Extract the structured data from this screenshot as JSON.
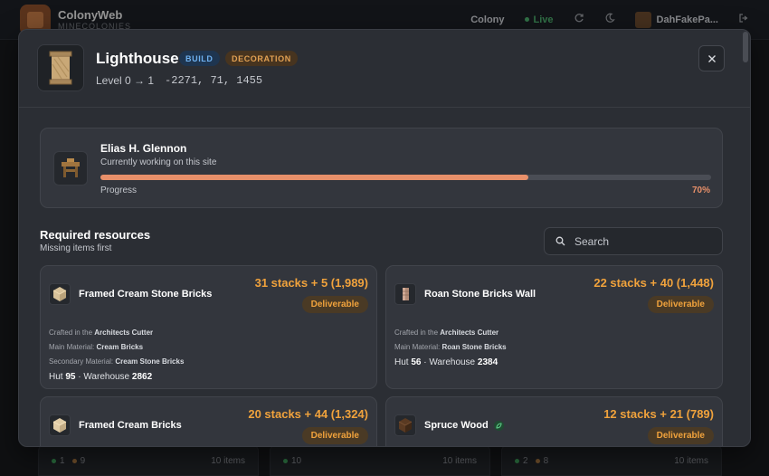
{
  "app": {
    "title": "ColonyWeb",
    "subtitle": "MINECOLONIES",
    "nav_colony": "Colony",
    "live_label": "Live",
    "user_name": "DahFakePa..."
  },
  "background_cards": [
    {
      "green": "1",
      "orange": "9",
      "items": "10 items"
    },
    {
      "green": "10",
      "orange": "",
      "items": "10 items"
    },
    {
      "green": "2",
      "orange": "8",
      "items": "10 items"
    }
  ],
  "building": {
    "name": "Lighthouse",
    "tags": [
      "BUILD",
      "DECORATION"
    ],
    "level": "Level 0 → 1",
    "coords": "-2271, 71, 1455",
    "icon": "scroll-banner-icon"
  },
  "worker": {
    "name": "Elias H. Glennon",
    "status": "Currently working on this site",
    "progress_label": "Progress",
    "progress_value": 0.7,
    "progress_text": "70%",
    "icon": "workbench-icon"
  },
  "resources": {
    "title": "Required resources",
    "subtitle": "Missing items first",
    "search_placeholder": "Search",
    "items": [
      {
        "name": "Framed Cream Stone Bricks",
        "count": "31 stacks + 5 (1,989)",
        "status": "Deliverable",
        "crafted_label": "Crafted in the ",
        "crafted_in": "Architects Cutter",
        "main_label": "Main Material: ",
        "main_material": "Cream Bricks",
        "secondary_label": "Secondary Material: ",
        "secondary_material": "Cream Stone Bricks",
        "hut_label": "Hut ",
        "hut": "95",
        "warehouse_label": " · Warehouse ",
        "warehouse": "2862",
        "icon": "cream-brick-block-icon"
      },
      {
        "name": "Roan Stone Bricks Wall",
        "count": "22 stacks + 40 (1,448)",
        "status": "Deliverable",
        "crafted_label": "Crafted in the ",
        "crafted_in": "Architects Cutter",
        "main_label": "Main Material: ",
        "main_material": "Roan Stone Bricks",
        "hut_label": "Hut ",
        "hut": "56",
        "warehouse_label": " · Warehouse ",
        "warehouse": "2384",
        "icon": "stone-wall-icon"
      },
      {
        "name": "Framed Cream Bricks",
        "count": "20 stacks + 44 (1,324)",
        "status": "Deliverable",
        "icon": "cream-brick-block-icon"
      },
      {
        "name": "Spruce Wood",
        "count": "12 stacks + 21 (789)",
        "status": "Deliverable",
        "icon": "spruce-log-icon"
      }
    ]
  },
  "colors": {
    "accent_orange": "#f0a23c",
    "progress": "#e8906a",
    "build_tag": "#6fb1f0",
    "decoration_tag": "#e2a153",
    "live_green": "#4caf6d"
  }
}
